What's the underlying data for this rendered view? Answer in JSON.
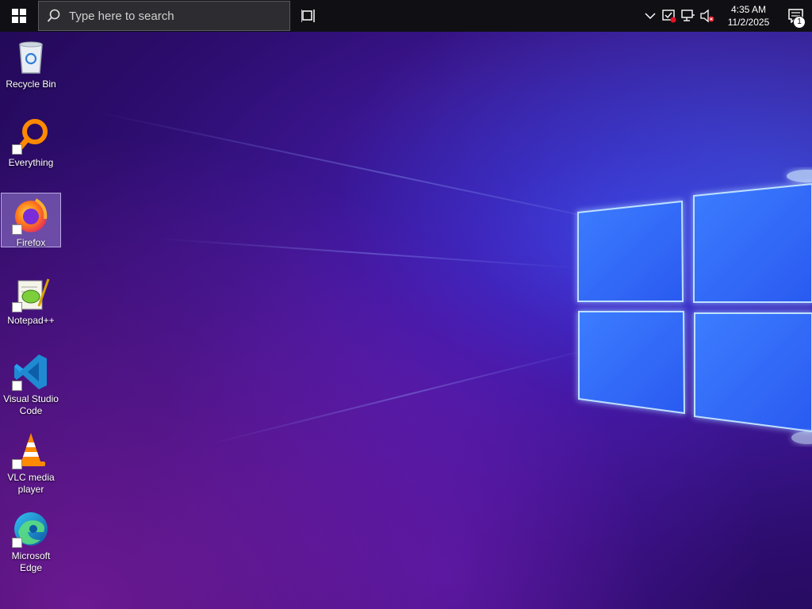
{
  "taskbar": {
    "search_placeholder": "Type here to search",
    "clock_time": "4:35 AM",
    "clock_date": "11/2/2025",
    "notification_count": "1"
  },
  "desktop": {
    "icons": [
      {
        "label": "Recycle Bin",
        "icon": "recycle-bin-icon"
      },
      {
        "label": "Everything",
        "icon": "everything-search-icon"
      },
      {
        "label": "Firefox",
        "icon": "firefox-icon"
      },
      {
        "label": "Notepad++",
        "icon": "notepad-plus-plus-icon"
      },
      {
        "label": "Visual Studio Code",
        "icon": "vscode-icon"
      },
      {
        "label": "VLC media player",
        "icon": "vlc-icon"
      },
      {
        "label": "Microsoft Edge",
        "icon": "edge-icon"
      }
    ],
    "selected": "Firefox"
  },
  "colors": {
    "taskbar_bg": "#101014",
    "accent_blue": "#3a7bff",
    "selection": "#aa96e6"
  }
}
